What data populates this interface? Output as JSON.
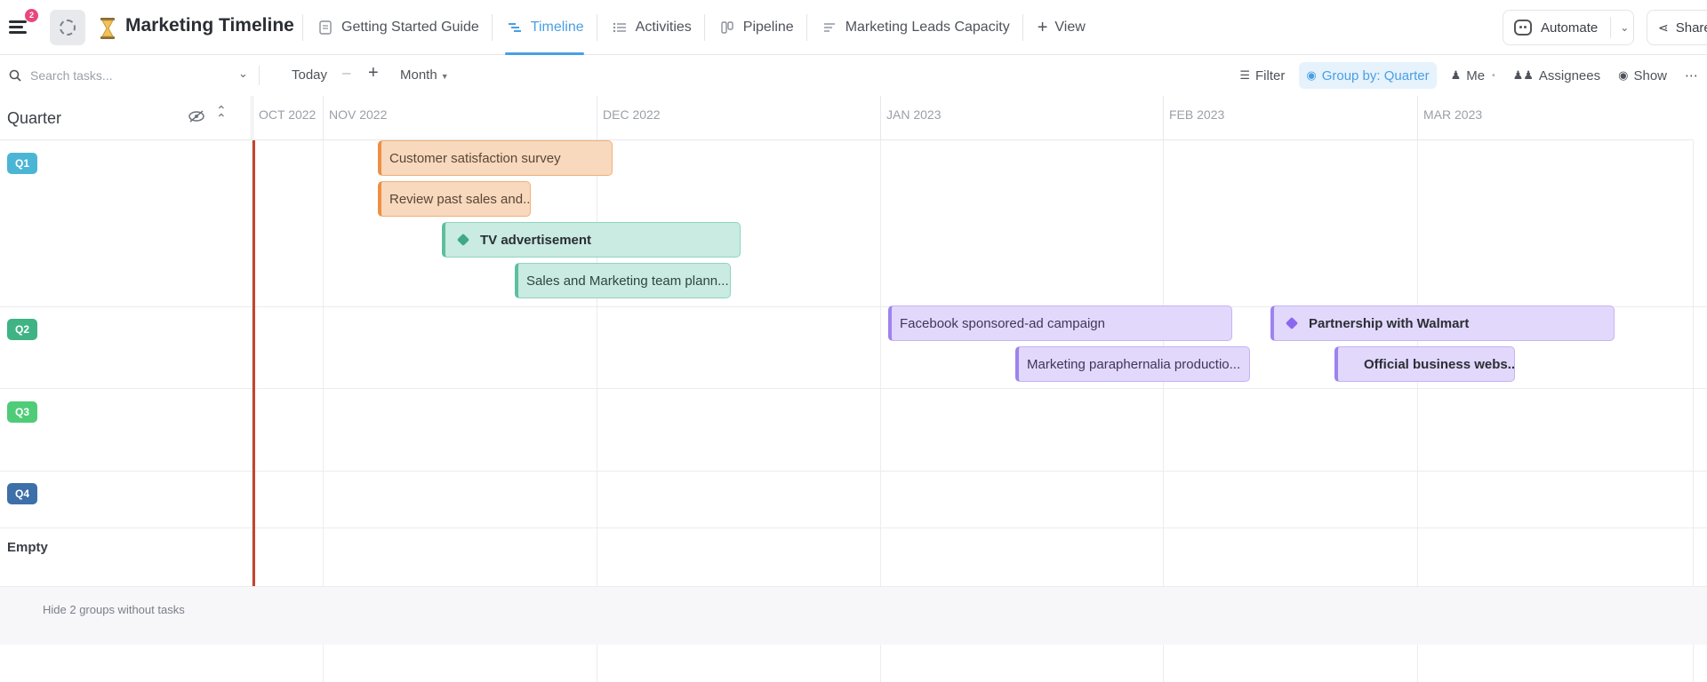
{
  "header": {
    "notification_count": "2",
    "title": "Marketing Timeline",
    "views": [
      {
        "label": "Getting Started Guide",
        "icon": "doc-icon"
      },
      {
        "label": "Timeline",
        "icon": "timeline-icon",
        "active": true
      },
      {
        "label": "Activities",
        "icon": "list-icon"
      },
      {
        "label": "Pipeline",
        "icon": "board-icon"
      },
      {
        "label": "Marketing Leads Capacity",
        "icon": "workload-icon"
      }
    ],
    "add_view_label": "View",
    "automate_label": "Automate",
    "share_label": "Share"
  },
  "toolbar": {
    "search_placeholder": "Search tasks...",
    "today_label": "Today",
    "zoom_minus": "–",
    "zoom_plus": "+",
    "scale_label": "Month",
    "filter_label": "Filter",
    "group_by_label": "Group by: Quarter",
    "me_label": "Me",
    "assignees_label": "Assignees",
    "show_label": "Show"
  },
  "timeline": {
    "group_header": "Quarter",
    "months": [
      "OCT 2022",
      "NOV 2022",
      "DEC 2022",
      "JAN 2023",
      "FEB 2023",
      "MAR 2023"
    ],
    "groups": [
      {
        "label": "Q1",
        "color": "#4bb5d6"
      },
      {
        "label": "Q2",
        "color": "#3fb384"
      },
      {
        "label": "Q3",
        "color": "#4fcc77"
      },
      {
        "label": "Q4",
        "color": "#3d6fa8"
      }
    ],
    "empty_label": "Empty",
    "tasks": [
      {
        "name": "Customer satisfaction survey",
        "group": "Q1",
        "color": "orange",
        "milestone": false
      },
      {
        "name": "Review past sales and...",
        "group": "Q1",
        "color": "orange",
        "milestone": false
      },
      {
        "name": "TV advertisement",
        "group": "Q1",
        "color": "teal",
        "milestone": true
      },
      {
        "name": "Sales and Marketing team plann...",
        "group": "Q1",
        "color": "teal",
        "milestone": false
      },
      {
        "name": "Facebook sponsored-ad campaign",
        "group": "Q2",
        "color": "purple",
        "milestone": false
      },
      {
        "name": "Marketing paraphernalia productio...",
        "group": "Q2",
        "color": "purple",
        "milestone": false
      },
      {
        "name": "Partnership with Walmart",
        "group": "Q2",
        "color": "purple",
        "milestone": true
      },
      {
        "name": "Official business webs...",
        "group": "Q2",
        "color": "purple",
        "milestone": true
      }
    ],
    "footer_label": "Hide 2 groups without tasks"
  },
  "colors": {
    "accent": "#4a9fe3",
    "today_line": "#c8442f"
  }
}
